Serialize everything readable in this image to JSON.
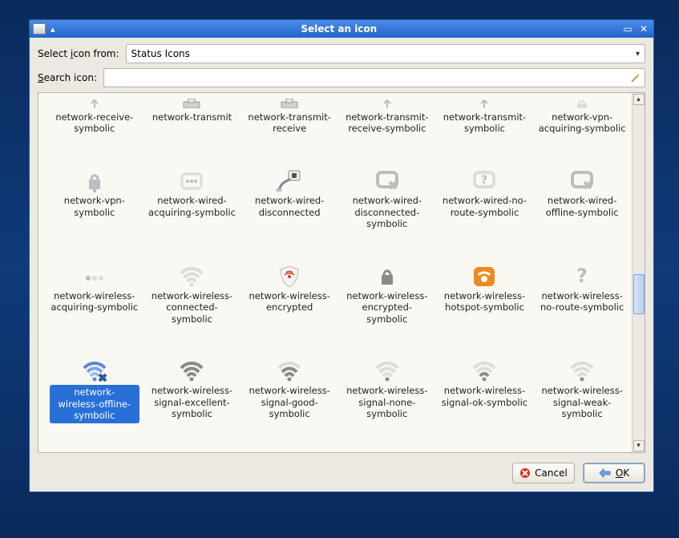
{
  "window": {
    "title": "Select an icon"
  },
  "form": {
    "select_label_pre": "Select ",
    "select_label_key": "i",
    "select_label_post": "con from:",
    "combo_value": "Status Icons",
    "search_label_pre": "",
    "search_label_key": "S",
    "search_label_post": "earch icon:",
    "search_value": ""
  },
  "icons": [
    {
      "id": "network-receive-symbolic",
      "label": "network-receive-symbolic",
      "glyph": "partial-arrow"
    },
    {
      "id": "network-transmit",
      "label": "network-transmit",
      "glyph": "partial-device"
    },
    {
      "id": "network-transmit-receive",
      "label": "network-transmit-receive",
      "glyph": "partial-device"
    },
    {
      "id": "network-transmit-receive-symbolic",
      "label": "network-transmit-receive-symbolic",
      "glyph": "partial-arrow"
    },
    {
      "id": "network-transmit-symbolic",
      "label": "network-transmit-symbolic",
      "glyph": "partial-arrow"
    },
    {
      "id": "network-vpn-acquiring-symbolic",
      "label": "network-vpn-acquiring-symbolic",
      "glyph": "partial-lock"
    },
    {
      "id": "network-vpn-symbolic",
      "label": "network-vpn-symbolic",
      "glyph": "lock-gray"
    },
    {
      "id": "network-wired-acquiring-symbolic",
      "label": "network-wired-acquiring-symbolic",
      "glyph": "dots-box"
    },
    {
      "id": "network-wired-disconnected",
      "label": "network-wired-disconnected",
      "glyph": "plug-color"
    },
    {
      "id": "network-wired-disconnected-symbolic",
      "label": "network-wired-disconnected-symbolic",
      "glyph": "box-x"
    },
    {
      "id": "network-wired-no-route-symbolic",
      "label": "network-wired-no-route-symbolic",
      "glyph": "box-q"
    },
    {
      "id": "network-wired-offline-symbolic",
      "label": "network-wired-offline-symbolic",
      "glyph": "box-x"
    },
    {
      "id": "network-wireless-acquiring-symbolic",
      "label": "network-wireless-acquiring-symbolic",
      "glyph": "dots"
    },
    {
      "id": "network-wireless-connected-symbolic",
      "label": "network-wireless-connected-symbolic",
      "glyph": "wifi-faint"
    },
    {
      "id": "network-wireless-encrypted",
      "label": "network-wireless-encrypted",
      "glyph": "shield"
    },
    {
      "id": "network-wireless-encrypted-symbolic",
      "label": "network-wireless-encrypted-symbolic",
      "glyph": "lock-dark"
    },
    {
      "id": "network-wireless-hotspot-symbolic",
      "label": "network-wireless-hotspot-symbolic",
      "glyph": "hotspot"
    },
    {
      "id": "network-wireless-no-route-symbolic",
      "label": "network-wireless-no-route-symbolic",
      "glyph": "question"
    },
    {
      "id": "network-wireless-offline-symbolic",
      "label": "network-wireless-offline-symbolic",
      "glyph": "wifi-x",
      "selected": true
    },
    {
      "id": "network-wireless-signal-excellent-symbolic",
      "label": "network-wireless-signal-excellent-symbolic",
      "glyph": "wifi-4"
    },
    {
      "id": "network-wireless-signal-good-symbolic",
      "label": "network-wireless-signal-good-symbolic",
      "glyph": "wifi-3"
    },
    {
      "id": "network-wireless-signal-none-symbolic",
      "label": "network-wireless-signal-none-symbolic",
      "glyph": "wifi-0"
    },
    {
      "id": "network-wireless-signal-ok-symbolic",
      "label": "network-wireless-signal-ok-symbolic",
      "glyph": "wifi-2"
    },
    {
      "id": "network-wireless-signal-weak-symbolic",
      "label": "network-wireless-signal-weak-symbolic",
      "glyph": "wifi-1"
    }
  ],
  "buttons": {
    "cancel": "Cancel",
    "ok_key": "O",
    "ok_post": "K"
  }
}
